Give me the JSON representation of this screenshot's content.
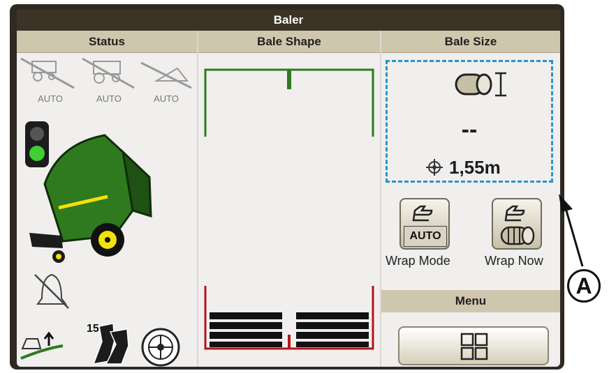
{
  "app": {
    "title": "Baler"
  },
  "columns": {
    "status": "Status",
    "bale_shape": "Bale Shape",
    "bale_size": "Bale Size"
  },
  "status": {
    "auto_labels": [
      "AUTO",
      "AUTO",
      "AUTO"
    ],
    "counter_value": "15"
  },
  "bale_size": {
    "current_value": "--",
    "target_diameter": "1,55m"
  },
  "buttons": {
    "wrap_mode_auto": "AUTO",
    "wrap_mode_label": "Wrap Mode",
    "wrap_now_label": "Wrap Now"
  },
  "menu": {
    "label": "Menu"
  },
  "callout": {
    "label": "A"
  },
  "colors": {
    "accent_blue": "#2a94c9",
    "john_deere_green": "#2f7a1f",
    "john_deere_yellow": "#f2e10c",
    "shape_red": "#b3141a",
    "header_tan": "#cfc7ad"
  },
  "icons": {
    "status": [
      "tractor-auto-icon",
      "implement-auto-icon",
      "hitch-auto-icon",
      "traffic-light-icon",
      "round-baler-icon",
      "alarm-off-icon",
      "pickup-raise-icon",
      "knife-icon",
      "rotor-icon"
    ],
    "bale_size": [
      "bale-diameter-icon",
      "crosshair-icon"
    ],
    "buttons": [
      "hand-pointer-icon",
      "wrap-net-icon",
      "menu-grid-icon"
    ]
  }
}
